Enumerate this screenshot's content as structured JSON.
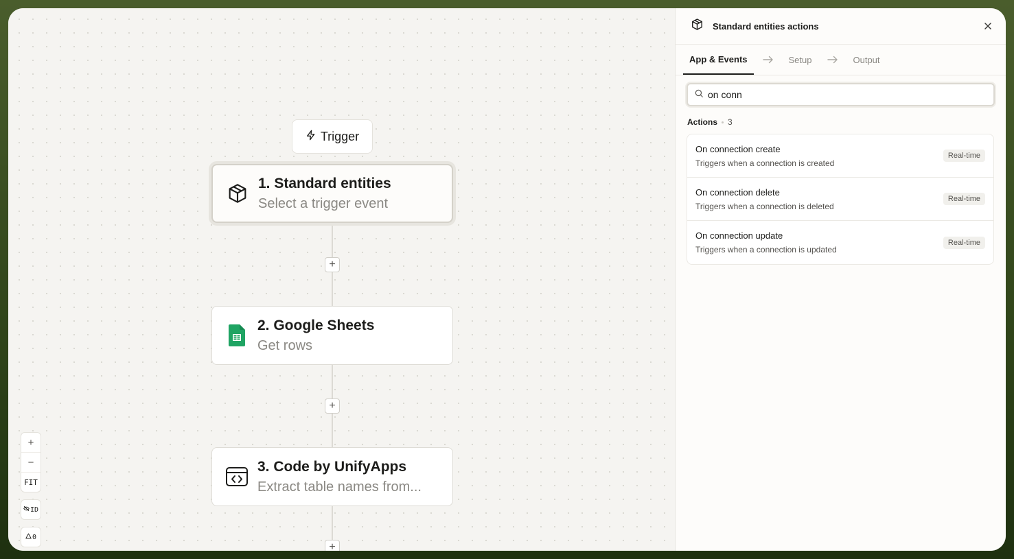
{
  "canvas": {
    "trigger_label": "Trigger",
    "nodes": [
      {
        "title": "1. Standard entities",
        "subtitle": "Select a trigger event",
        "icon": "box-icon"
      },
      {
        "title": "2. Google Sheets",
        "subtitle": "Get rows",
        "icon": "google-sheets-icon"
      },
      {
        "title": "3. Code by UnifyApps",
        "subtitle": "Extract table names from...",
        "icon": "code-icon"
      }
    ],
    "controls": {
      "zoom_in": "+",
      "zoom_out": "−",
      "fit": "FIT",
      "id_toggle": "ID",
      "warnings": "0"
    }
  },
  "panel": {
    "title": "Standard entities actions",
    "tabs": [
      {
        "label": "App & Events"
      },
      {
        "label": "Setup"
      },
      {
        "label": "Output"
      }
    ],
    "search": {
      "value": "on conn",
      "placeholder": ""
    },
    "section": {
      "label": "Actions",
      "count": "3"
    },
    "results": [
      {
        "title": "On connection create",
        "desc": "Triggers when a connection is created",
        "badge": "Real-time"
      },
      {
        "title": "On connection delete",
        "desc": "Triggers when a connection is deleted",
        "badge": "Real-time"
      },
      {
        "title": "On connection update",
        "desc": "Triggers when a connection is updated",
        "badge": "Real-time"
      }
    ]
  },
  "colors": {
    "sheets_green": "#1fa463",
    "text_primary": "#1d1d1b",
    "text_muted": "#8a8883"
  }
}
